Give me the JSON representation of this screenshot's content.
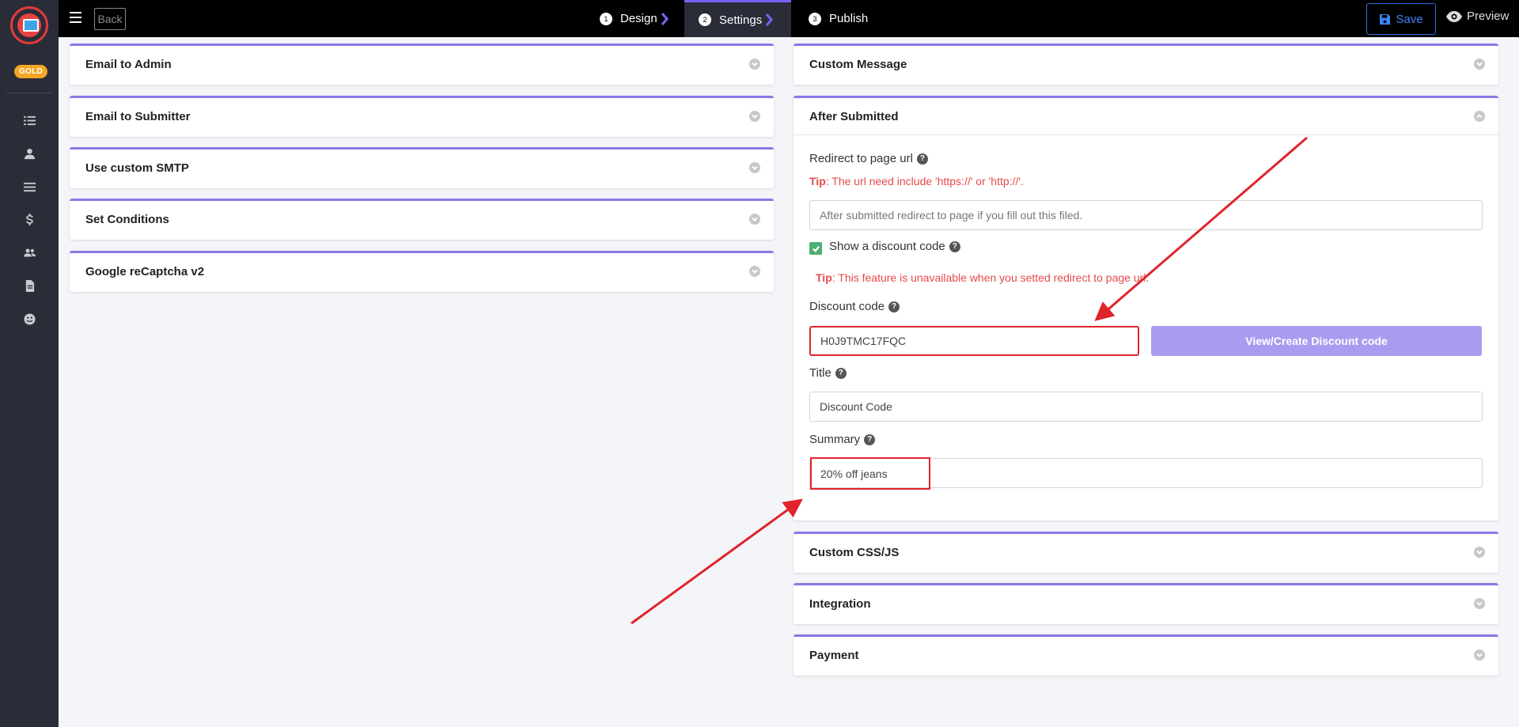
{
  "sidebar": {
    "badge": "GOLD",
    "icons": [
      "list-icon",
      "user-icon",
      "menu-lines-icon",
      "dollar-icon",
      "users-icon",
      "document-icon",
      "smile-icon"
    ]
  },
  "topbar": {
    "back_label": "Back",
    "steps": [
      {
        "num": "1",
        "label": "Design"
      },
      {
        "num": "2",
        "label": "Settings"
      },
      {
        "num": "3",
        "label": "Publish"
      }
    ],
    "save_label": "Save",
    "preview_label": "Preview"
  },
  "left_panels": [
    {
      "title": "Email to Admin"
    },
    {
      "title": "Email to Submitter"
    },
    {
      "title": "Use custom SMTP"
    },
    {
      "title": "Set Conditions"
    },
    {
      "title": "Google reCaptcha v2"
    }
  ],
  "right_panels": {
    "custom_message": "Custom Message",
    "after_submitted": {
      "title": "After Submitted",
      "redirect_label": "Redirect to page url",
      "tip_prefix": "Tip",
      "redirect_tip": ": The url need include 'https://' or 'http://'.",
      "redirect_placeholder": "After submitted redirect to page if you fill out this filed.",
      "show_discount_label": "Show a discount code",
      "discount_tip": ": This feature is unavailable when you setted redirect to page url.",
      "discount_code_label": "Discount code",
      "discount_code_value": "H0J9TMC17FQC",
      "view_create_button": "View/Create Discount code",
      "title_label": "Title",
      "title_value": "Discount Code",
      "summary_label": "Summary",
      "summary_value": "20% off jeans"
    },
    "custom_css_js": "Custom CSS/JS",
    "integration": "Integration",
    "payment": "Payment"
  },
  "colors": {
    "accent": "#8a78e6",
    "tip": "#e64a4a",
    "highlight": "#e0242c",
    "save": "#3e82f7"
  }
}
